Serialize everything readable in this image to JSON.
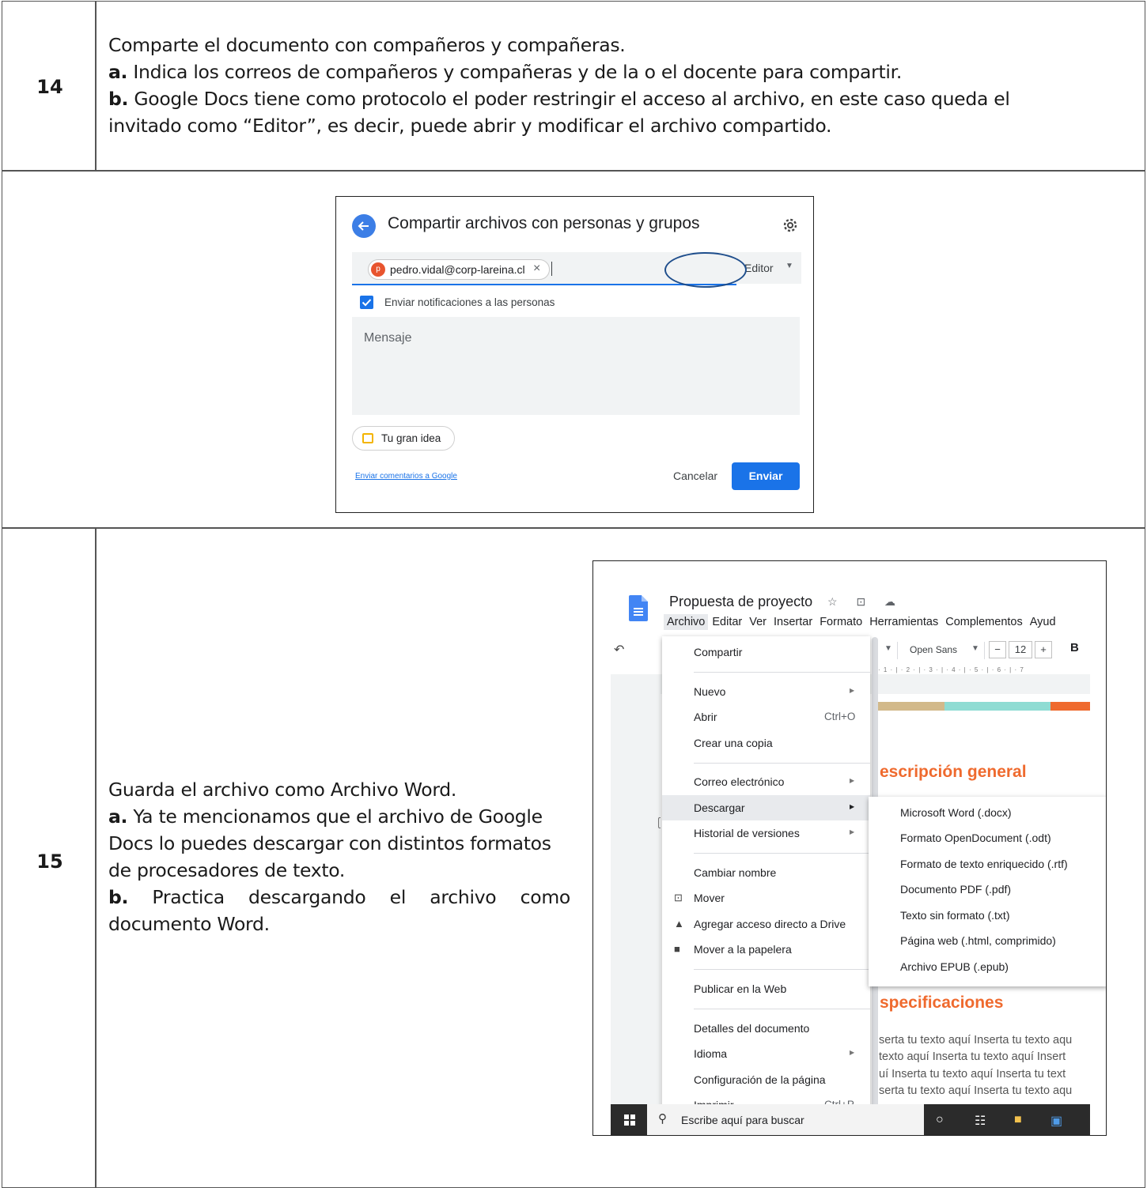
{
  "steps": [
    {
      "number": "14",
      "intro": "Comparte el documento con compañeros y compañeras.",
      "items": [
        {
          "label": "a.",
          "text": " Indica los correos de compañeros y compañeras y de la o el docente para compartir."
        },
        {
          "label": "b.",
          "text": " Google Docs tiene como protocolo el poder restringir el acceso al archivo, en este caso queda el invitado como “Editor”, es decir, puede abrir y modificar el archivo compartido."
        }
      ]
    },
    {
      "number": "15",
      "intro": "Guarda el archivo como Archivo Word.",
      "items": [
        {
          "label": "a.",
          "text": " Ya te mencionamos que el archivo de Google Docs lo puedes descargar con distintos formatos de procesadores de texto."
        },
        {
          "label": "b.",
          "text": " Practica descargando el archivo como documento Word."
        }
      ]
    }
  ],
  "share_dialog": {
    "title": "Compartir archivos con personas y grupos",
    "chip_avatar": "p",
    "chip_email": "pedro.vidal@corp-lareina.cl",
    "chip_close": "×",
    "role": "Editor",
    "notify_label": "Enviar notificaciones a las personas",
    "message_placeholder": "Mensaje",
    "attachment": "Tu gran idea",
    "feedback_link": "Enviar comentarios a Google",
    "cancel": "Cancelar",
    "send": "Enviar"
  },
  "docs_window": {
    "doc_title": "Propuesta de proyecto",
    "title_icons": "☆ ⊡ ☁",
    "menu": [
      "Archivo",
      "Editar",
      "Ver",
      "Insertar",
      "Formato",
      "Herramientas",
      "Complementos",
      "Ayud"
    ],
    "active_menu": "Archivo",
    "toolbar": {
      "font": "Open Sans",
      "size": "12",
      "minus": "−",
      "plus": "+",
      "bold": "B",
      "undo": "↶"
    },
    "ruler": "· 1 · | · 2 · | · 3 · | · 4 · | · 5 · | · 6 · | · 7",
    "file_menu": [
      {
        "label": "Compartir"
      },
      {
        "label": "Nuevo",
        "submenu": true
      },
      {
        "label": "Abrir",
        "shortcut": "Ctrl+O"
      },
      {
        "label": "Crear una copia"
      },
      {
        "label": "Correo electrónico",
        "submenu": true
      },
      {
        "label": "Descargar",
        "submenu": true,
        "highlighted": true
      },
      {
        "label": "Historial de versiones",
        "submenu": true
      },
      {
        "label": "Cambiar nombre"
      },
      {
        "label": "Mover",
        "icon": "move-icon"
      },
      {
        "label": "Agregar acceso directo a Drive",
        "icon": "drive-shortcut-icon"
      },
      {
        "label": "Mover a la papelera",
        "icon": "trash-icon"
      },
      {
        "label": "Publicar en la Web"
      },
      {
        "label": "Detalles del documento"
      },
      {
        "label": "Idioma",
        "submenu": true
      },
      {
        "label": "Configuración de la página"
      },
      {
        "label": "Imprimir",
        "shortcut": "Ctrl+P",
        "icon": "print-icon"
      }
    ],
    "download_submenu": [
      "Microsoft Word (.docx)",
      "Formato OpenDocument (.odt)",
      "Formato de texto enriquecido (.rtf)",
      "Documento PDF (.pdf)",
      "Texto sin formato (.txt)",
      "Página web (.html, comprimido)",
      "Archivo EPUB (.epub)"
    ],
    "doc_headings": [
      "escripción general",
      "specificaciones"
    ],
    "doc_body_lines": [
      "serta tu texto aquí Inserta tu texto aqu",
      "texto aquí Inserta tu texto aquí Insert",
      "uí Inserta tu texto aquí Inserta tu text",
      "serta tu texto aquí Inserta tu texto aqu"
    ],
    "accent_colors": [
      "#d2b98a",
      "#8fdcd3",
      "#ef6a2e"
    ],
    "taskbar_search": "Escribe aquí para buscar"
  }
}
